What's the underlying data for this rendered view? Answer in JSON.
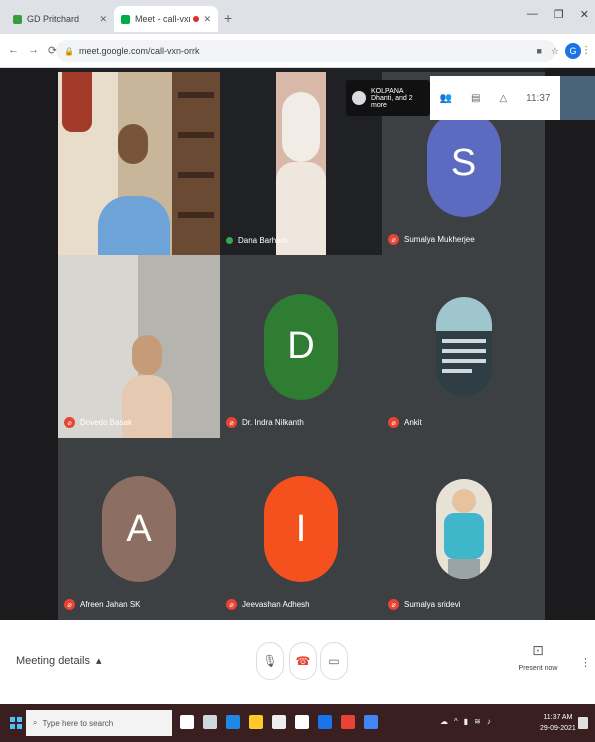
{
  "browser": {
    "tabs": [
      {
        "label": "GD Pritchard",
        "favicon_color": "#3a9b3a"
      },
      {
        "label": "Meet - call-vxn-orrk",
        "favicon_color": "#00ac47"
      }
    ],
    "url": "meet.google.com/call-vxn-orrk",
    "profile_initial": "G"
  },
  "meeting": {
    "participants": [
      {
        "name": "",
        "mic": "none",
        "kind": "video"
      },
      {
        "name": "Dana Barham",
        "mic": "on",
        "kind": "video"
      },
      {
        "name": "Sumalya Mukherjee",
        "mic": "off",
        "kind": "initial",
        "initial": "S",
        "color": "#5c6bc0"
      },
      {
        "name": "Dovedo Basak",
        "mic": "off",
        "kind": "video"
      },
      {
        "name": "Dr. Indra Nilkanth",
        "mic": "off",
        "kind": "initial",
        "initial": "D",
        "color": "#2e7d32"
      },
      {
        "name": "Ankit",
        "mic": "off",
        "kind": "photo"
      },
      {
        "name": "Afreen Jahan SK",
        "mic": "off",
        "kind": "initial",
        "initial": "A",
        "color": "#8d6e63"
      },
      {
        "name": "Jeevashan Adhesh",
        "mic": "off",
        "kind": "initial",
        "initial": "I",
        "color": "#f4511e"
      },
      {
        "name": "Sumalya sridevi",
        "mic": "off",
        "kind": "photo"
      }
    ],
    "presenting_chip": "KOLPANA Dhanti, and 2 more",
    "timer": "11:37"
  },
  "bottombar": {
    "meeting_details_label": "Meeting details",
    "present_label": "Present now"
  },
  "taskbar": {
    "search_placeholder": "Type here to search",
    "time": "11:37 AM",
    "date": "29-09-2021"
  },
  "colors": {
    "stage": "#202124",
    "hangup": "#ea4335",
    "taskbar": "#3a1f20"
  }
}
